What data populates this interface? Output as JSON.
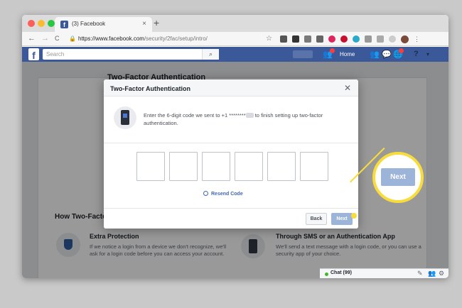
{
  "browser": {
    "tab_title": "(3) Facebook",
    "tab_close": "×",
    "new_tab": "+",
    "back": "←",
    "forward": "→",
    "reload": "C",
    "url_host": "https://www.facebook.com",
    "url_path": "/security/2fac/setup/intro/",
    "star": "☆"
  },
  "facebook": {
    "logo": "f",
    "search_placeholder": "Search",
    "search_icon": "⌕",
    "home_label": "Home",
    "help_icon": "?",
    "menu_icon": "▾"
  },
  "page": {
    "title": "Two-Factor Authentication",
    "how_title": "How Two-Facto",
    "feature1_title": "Extra Protection",
    "feature1_desc": "If we notice a login from a device we don't recognize, we'll ask for a login code before you can access your account.",
    "feature2_title": "Through SMS or an Authentication App",
    "feature2_desc": "We'll send a text message with a login code, or you can use a security app of your choice."
  },
  "dialog": {
    "title": "Two-Factor Authentication",
    "close": "✕",
    "message_before": "Enter the 6-digit code we sent to +1 ********",
    "message_after": " to finish setting up two-factor authentication.",
    "code_boxes": [
      "",
      "",
      "",
      "",
      "",
      ""
    ],
    "resend_label": "Resend Code",
    "back_label": "Back",
    "next_label": "Next"
  },
  "chat": {
    "label": "Chat (99)"
  },
  "callout": {
    "label": "Next"
  },
  "colors": {
    "facebook_blue": "#3b5998",
    "next_disabled": "#9cb4d8",
    "callout_yellow": "#f7dc3b"
  }
}
